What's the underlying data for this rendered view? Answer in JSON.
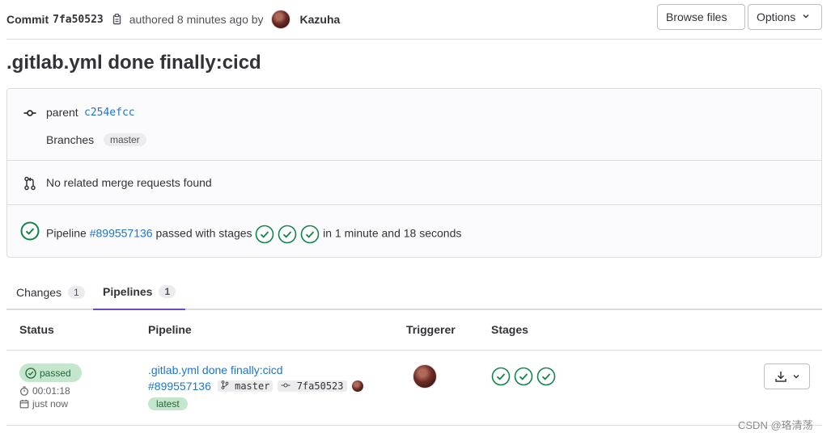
{
  "header": {
    "commit_word": "Commit",
    "sha": "7fa50523",
    "authored_text": "authored 8 minutes ago by",
    "author": "Kazuha",
    "browse_files": "Browse files",
    "options": "Options"
  },
  "title": ".gitlab.yml done finally:cicd",
  "info": {
    "parent_label": "parent",
    "parent_sha": "c254efcc",
    "branches_label": "Branches",
    "branch": "master",
    "merge_requests": "No related merge requests found",
    "pipeline_prefix": "Pipeline",
    "pipeline_id": "#899557136",
    "pipeline_middle": "passed with stages",
    "pipeline_duration": "in 1 minute and 18 seconds"
  },
  "tabs": [
    {
      "label": "Changes",
      "count": "1"
    },
    {
      "label": "Pipelines",
      "count": "1"
    }
  ],
  "table": {
    "headers": {
      "status": "Status",
      "pipeline": "Pipeline",
      "triggerer": "Triggerer",
      "stages": "Stages"
    },
    "row": {
      "status": "passed",
      "duration": "00:01:18",
      "finished": "just now",
      "commit_title": ".gitlab.yml done finally:cicd",
      "pipeline_id": "#899557136",
      "branch": "master",
      "sha": "7fa50523",
      "label": "latest"
    }
  },
  "watermark": "CSDN @珞清荡",
  "icons": {
    "copy": "copy-icon",
    "commit": "commit-icon",
    "merge_request": "merge-request-icon",
    "status_success": "status-success-icon",
    "timer": "timer-icon",
    "calendar": "calendar-icon",
    "branch": "branch-icon",
    "download": "download-icon",
    "chevron": "chevron-down-icon"
  },
  "colors": {
    "link": "#1f75cb",
    "success": "#108548",
    "success_bg": "#c3e6cd",
    "tab_active": "#6e49cb"
  }
}
